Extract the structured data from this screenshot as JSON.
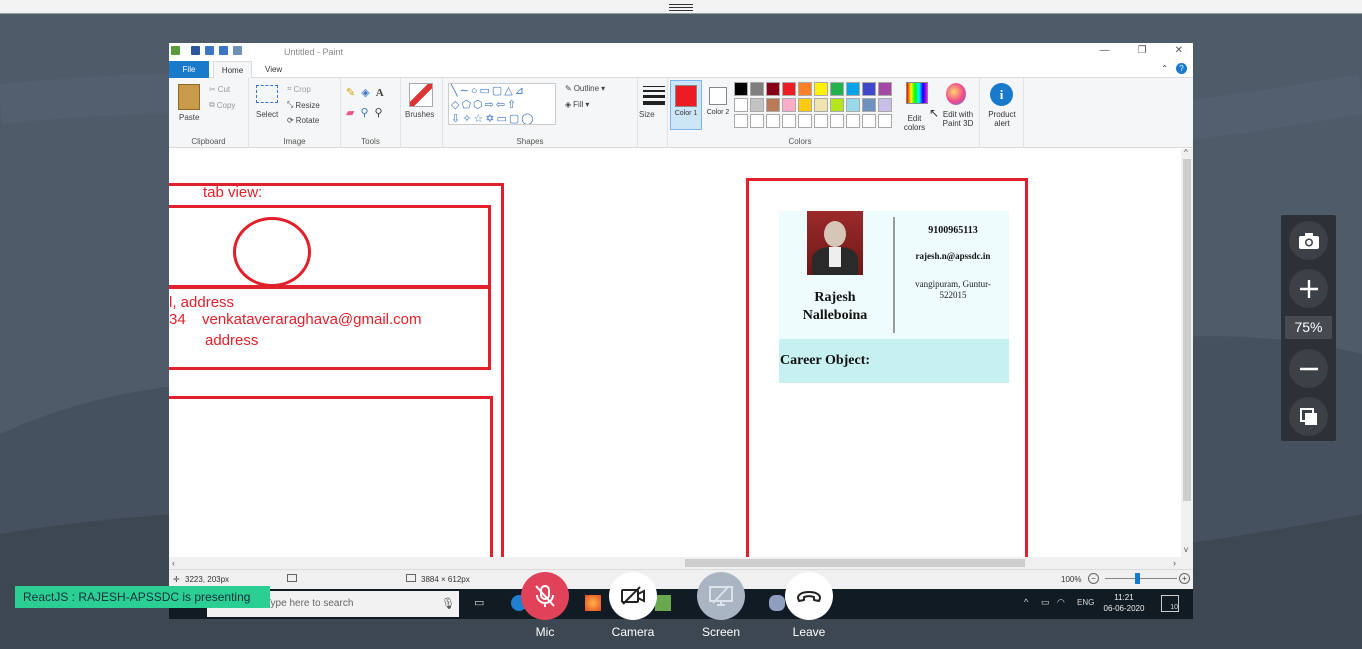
{
  "window": {
    "title": "Untitled - Paint"
  },
  "menu": {
    "file": "File",
    "home": "Home",
    "view": "View"
  },
  "ribbon": {
    "clipboard": {
      "paste": "Paste",
      "cut": "Cut",
      "copy": "Copy",
      "label": "Clipboard"
    },
    "image": {
      "select": "Select",
      "crop": "Crop",
      "resize": "Resize",
      "rotate": "Rotate",
      "label": "Image"
    },
    "tools": {
      "label": "Tools"
    },
    "brushes": {
      "label": "Brushes"
    },
    "shapes": {
      "outline": "Outline",
      "fill": "Fill",
      "label": "Shapes"
    },
    "size": {
      "label": "Size"
    },
    "colors": {
      "color1": "Color 1",
      "color2": "Color 2",
      "label": "Colors",
      "edit_colors": "Edit colors",
      "edit_paint3d": "Edit with Paint 3D",
      "product_alert": "Product alert",
      "palette_row1": [
        "#000000",
        "#7f7f7f",
        "#880015",
        "#ed1c24",
        "#ff7f27",
        "#fff200",
        "#22b14c",
        "#00a2e8",
        "#3f48cc",
        "#a349a4"
      ],
      "palette_row2": [
        "#ffffff",
        "#c3c3c3",
        "#b97a57",
        "#ffaec9",
        "#ffc90e",
        "#efe4b0",
        "#b5e61d",
        "#99d9ea",
        "#7092be",
        "#c8bfe7"
      ],
      "active_color1": "#ed1c24"
    }
  },
  "canvas": {
    "tab_view": "tab view:",
    "line_address": "l, address",
    "line_email_prefix": "34",
    "line_email": "venkataveraraghava@gmail.com",
    "line_address2": "address",
    "card": {
      "name_first": "Rajesh",
      "name_last": "Nalleboina",
      "phone": "9100965113",
      "email": "rajesh.n@apssdc.in",
      "address": "vangipuram, Guntur-522015",
      "career": "Career Object:"
    }
  },
  "status": {
    "cursor": "3223, 203px",
    "size": "3884 × 612px",
    "zoom": "100%"
  },
  "taskbar": {
    "search_placeholder": "Type here to search",
    "lang": "ENG",
    "time": "11:21",
    "date": "06-06-2020",
    "notif": "10"
  },
  "meeting": {
    "zoom_level": "75%",
    "presenting": "ReactJS : RAJESH-APSSDC is presenting",
    "mic": "Mic",
    "camera": "Camera",
    "screen": "Screen",
    "leave": "Leave"
  }
}
